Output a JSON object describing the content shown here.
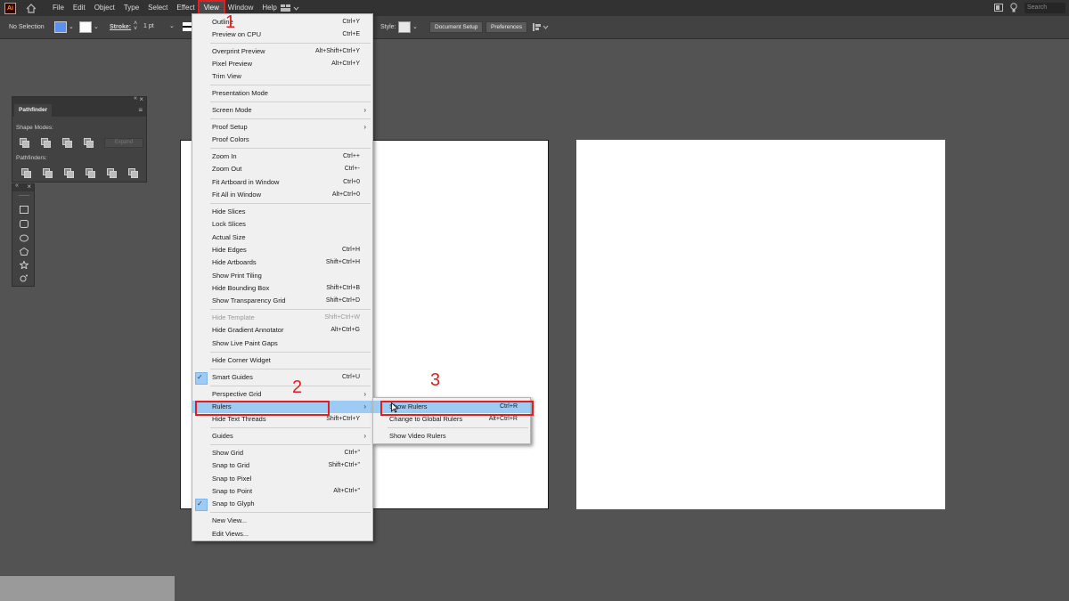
{
  "menubar": {
    "logo": "Ai",
    "items": [
      "File",
      "Edit",
      "Object",
      "Type",
      "Select",
      "Effect",
      "View",
      "Window",
      "Help"
    ],
    "search_placeholder": "Search"
  },
  "controlbar": {
    "selection": "No Selection",
    "stroke_label": "Stroke:",
    "stroke_value": "1 pt",
    "style_label": "Style:",
    "document_setup": "Document Setup",
    "preferences": "Preferences"
  },
  "pathfinder": {
    "tab": "Pathfinder",
    "shape_modes": "Shape Modes:",
    "pathfinders": "Pathfinders:",
    "expand": "Expand"
  },
  "view_menu": [
    {
      "label": "Outline",
      "shortcut": "Ctrl+Y"
    },
    {
      "label": "Preview on CPU",
      "shortcut": "Ctrl+E"
    },
    {
      "label": "Overprint Preview",
      "shortcut": "Alt+Shift+Ctrl+Y"
    },
    {
      "label": "Pixel Preview",
      "shortcut": "Alt+Ctrl+Y"
    },
    {
      "label": "Trim View",
      "shortcut": ""
    },
    {
      "label": "Presentation Mode",
      "shortcut": ""
    },
    {
      "label": "Screen Mode",
      "shortcut": ""
    },
    {
      "label": "Proof Setup",
      "shortcut": ""
    },
    {
      "label": "Proof Colors",
      "shortcut": ""
    },
    {
      "label": "Zoom In",
      "shortcut": "Ctrl++"
    },
    {
      "label": "Zoom Out",
      "shortcut": "Ctrl+-"
    },
    {
      "label": "Fit Artboard in Window",
      "shortcut": "Ctrl+0"
    },
    {
      "label": "Fit All in Window",
      "shortcut": "Alt+Ctrl+0"
    },
    {
      "label": "Hide Slices",
      "shortcut": ""
    },
    {
      "label": "Lock Slices",
      "shortcut": ""
    },
    {
      "label": "Actual Size",
      "shortcut": ""
    },
    {
      "label": "Hide Edges",
      "shortcut": "Ctrl+H"
    },
    {
      "label": "Hide Artboards",
      "shortcut": "Shift+Ctrl+H"
    },
    {
      "label": "Show Print Tiling",
      "shortcut": ""
    },
    {
      "label": "Hide Bounding Box",
      "shortcut": "Shift+Ctrl+B"
    },
    {
      "label": "Show Transparency Grid",
      "shortcut": "Shift+Ctrl+D"
    },
    {
      "label": "Hide Template",
      "shortcut": "Shift+Ctrl+W"
    },
    {
      "label": "Hide Gradient Annotator",
      "shortcut": "Alt+Ctrl+G"
    },
    {
      "label": "Show Live Paint Gaps",
      "shortcut": ""
    },
    {
      "label": "Hide Corner Widget",
      "shortcut": ""
    },
    {
      "label": "Smart Guides",
      "shortcut": "Ctrl+U"
    },
    {
      "label": "Perspective Grid",
      "shortcut": ""
    },
    {
      "label": "Rulers",
      "shortcut": ""
    },
    {
      "label": "Hide Text Threads",
      "shortcut": "Shift+Ctrl+Y"
    },
    {
      "label": "Guides",
      "shortcut": ""
    },
    {
      "label": "Show Grid",
      "shortcut": "Ctrl+\""
    },
    {
      "label": "Snap to Grid",
      "shortcut": "Shift+Ctrl+\""
    },
    {
      "label": "Snap to Pixel",
      "shortcut": ""
    },
    {
      "label": "Snap to Point",
      "shortcut": "Alt+Ctrl+\""
    },
    {
      "label": "Snap to Glyph",
      "shortcut": ""
    },
    {
      "label": "New View...",
      "shortcut": ""
    },
    {
      "label": "Edit Views...",
      "shortcut": ""
    }
  ],
  "rulers_submenu": [
    {
      "label": "Show Rulers",
      "shortcut": "Ctrl+R"
    },
    {
      "label": "Change to Global Rulers",
      "shortcut": "Alt+Ctrl+R"
    },
    {
      "label": "Show Video Rulers",
      "shortcut": ""
    }
  ],
  "steps": [
    "1",
    "2",
    "3"
  ],
  "colors": {
    "highlight": "#9ecbf3",
    "annotation_red": "#e02020",
    "fill_swatch": "#5b8ff0"
  }
}
